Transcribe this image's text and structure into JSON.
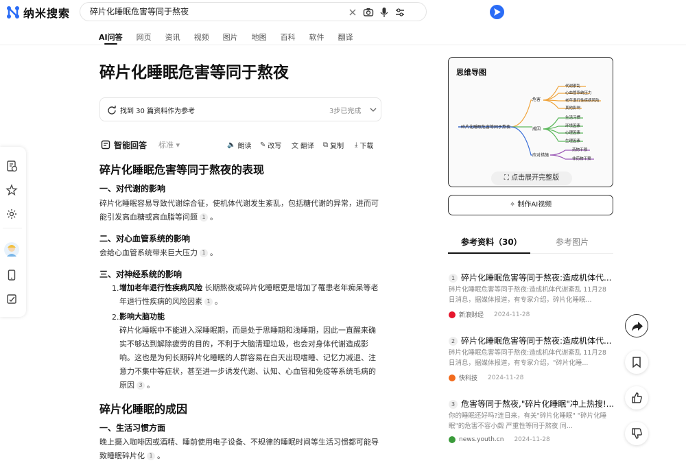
{
  "header": {
    "logo_text": "纳米搜索",
    "search_value": "碎片化睡眠危害等同于熬夜",
    "tabs": [
      {
        "label": "AI问答",
        "active": true
      },
      {
        "label": "网页"
      },
      {
        "label": "资讯"
      },
      {
        "label": "视频"
      },
      {
        "label": "图片"
      },
      {
        "label": "地图"
      },
      {
        "label": "百科"
      },
      {
        "label": "软件"
      },
      {
        "label": "翻译"
      }
    ]
  },
  "main": {
    "title": "碎片化睡眠危害等同于熬夜",
    "ref_text": "找到 30 篇资料作为参考",
    "ref_status": "3步已完成",
    "answer_label": "智能回答",
    "answer_mode": "标准",
    "tools": {
      "read": "朗读",
      "rewrite": "改写",
      "translate": "翻译",
      "copy": "复制",
      "download": "下载"
    }
  },
  "content": {
    "h_performance": "碎片化睡眠危害等同于熬夜的表现",
    "s1_title": "一、对代谢的影响",
    "s1_text": "碎片化睡眠容易导致代谢综合征，使机体代谢发生紊乱，包括糖代谢的异常，进而可能引发高血糖或高血脂等问题",
    "s2_title": "二、对心血管系统的影响",
    "s2_text": "会给心血管系统带来巨大压力",
    "s3_title": "三、对神经系统的影响",
    "li1_num": "1.",
    "li1_bold": "增加老年退行性疾病风险",
    "li1_text": "长期熬夜或碎片化睡眠更是增加了罹患老年痴呆等老年退行性疾病的风险因素",
    "li2_num": "2.",
    "li2_bold": "影响大脑功能",
    "li2_text": "碎片化睡眠中不能进入深睡眠期，而是处于思睡期和浅睡期，因此一直醒来确实不够达到解除疲劳的目的，不利于大脑清理垃圾，也会对身体代谢造成影响。这也是为何长期碎片化睡眠的人群容易在白天出现嗜睡、记忆力减退、注意力不集中等症状，甚至进一步诱发代谢、认知、心血管和免疫等系统毛病的原因",
    "h_cause": "碎片化睡眠的成因",
    "c1_title": "一、生活习惯方面",
    "c1_text": "晚上摄入咖啡因或酒精、睡前使用电子设备、不规律的睡眠时间等生活习惯都可能导致睡眠碎片化",
    "cite1": "1",
    "cite3": "3"
  },
  "mindmap": {
    "title": "思维导图",
    "root": "碎片化睡眠危害等同于熬夜",
    "branches": [
      {
        "label": "危害",
        "leaves": [
          "代谢紊乱",
          "心血管系统压力",
          "老年退行性疾病风险",
          "其他影响"
        ]
      },
      {
        "label": "成因",
        "leaves": [
          "生活习惯",
          "环境因素",
          "心理因素",
          "生理因素"
        ]
      },
      {
        "label": "应对措施",
        "leaves": [
          "药物干预",
          "非药物干预"
        ]
      }
    ],
    "expand_label": "点击展开完整版"
  },
  "video_btn": "制作AI视频",
  "ref_tabs": {
    "active": "参考资料（30）",
    "other": "参考图片"
  },
  "refs": [
    {
      "num": "1",
      "title": "碎片化睡眠危害等同于熬夜:造成机体代...",
      "snippet": "碎片化睡眠危害等同于熬夜:造成机体代谢紊乱 11月28日消息，据媒体报道，有专家介绍，碎片化睡眠...",
      "source": "新浪财经",
      "date": "2024-11-28",
      "color": "#e6162d"
    },
    {
      "num": "2",
      "title": "碎片化睡眠危害等同于熬夜:造成机体代...",
      "snippet": "碎片化睡眠危害等同于熬夜:造成机体代谢紊乱 11月28日消息，据媒体报道，有专家介绍，\"碎片化睡...",
      "source": "快科技",
      "date": "2024-11-28",
      "color": "#f26b1d"
    },
    {
      "num": "3",
      "title": "危害等同于熬夜,\"碎片化睡眠\"冲上热搜!...",
      "snippet": "你的睡眠还好吗?连日来，有关\"碎片化睡眠\" \"碎片化睡眠\"的危害不容小觑 严重性等同于熬夜 同...",
      "source": "news.youth.cn",
      "date": "2024-11-28",
      "color": "#3a9b3a"
    }
  ],
  "colors": {
    "accent": "#2a6cf6",
    "map_orange": "#f0a33a",
    "map_green": "#5cb85c",
    "map_purple": "#9b59b6",
    "map_blue": "#3b6fd8"
  }
}
